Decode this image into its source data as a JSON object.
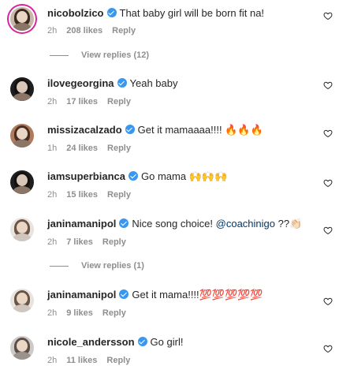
{
  "comments": [
    {
      "username": "nicobolzico",
      "text": "That baby girl will be born fit na!",
      "time": "2h",
      "likes": "208 likes",
      "reply": "Reply"
    },
    {
      "username": "ilovegeorgina",
      "text": "Yeah baby",
      "time": "2h",
      "likes": "17 likes",
      "reply": "Reply"
    },
    {
      "username": "missizacalzado",
      "text": "Get it mamaaaa!!!! 🔥🔥🔥",
      "time": "1h",
      "likes": "24 likes",
      "reply": "Reply"
    },
    {
      "username": "iamsuperbianca",
      "text": "Go mama 🙌🙌🙌",
      "time": "2h",
      "likes": "15 likes",
      "reply": "Reply"
    },
    {
      "username": "janinamanipol",
      "text_before": "Nice song choice! ",
      "mention": "@coachinigo",
      "text_after": " ??👏🏻",
      "time": "2h",
      "likes": "7 likes",
      "reply": "Reply"
    },
    {
      "username": "janinamanipol",
      "text": "Get it mama!!!!💯💯💯💯💯",
      "time": "2h",
      "likes": "9 likes",
      "reply": "Reply"
    },
    {
      "username": "nicole_andersson",
      "text": "Go girl!",
      "time": "2h",
      "likes": "11 likes",
      "reply": "Reply"
    }
  ],
  "view_replies": [
    "View replies (12)",
    "View replies (1)"
  ],
  "icons": {
    "like": "heart-icon",
    "verified": "verified-badge-icon"
  },
  "colors": {
    "verified": "#3897f0",
    "mention": "#00376b",
    "meta": "#8e8e8e"
  }
}
